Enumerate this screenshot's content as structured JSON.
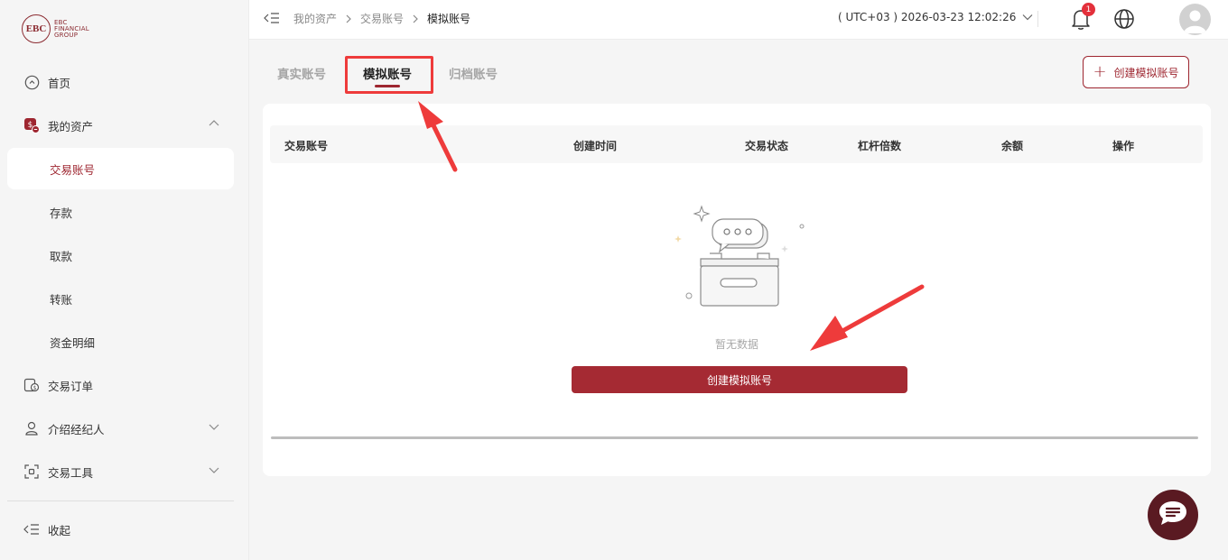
{
  "brand": {
    "logo_mark": "EBC",
    "logo_text_lines": [
      "EBC",
      "FINANCIAL",
      "GROUP"
    ]
  },
  "sidebar": {
    "items": [
      {
        "label": "首页",
        "icon": "home-icon"
      },
      {
        "label": "我的资产",
        "icon": "wallet-icon",
        "expanded": true
      },
      {
        "label": "交易账号",
        "active": true
      },
      {
        "label": "存款"
      },
      {
        "label": "取款"
      },
      {
        "label": "转账"
      },
      {
        "label": "资金明细"
      },
      {
        "label": "交易订单",
        "icon": "orders-icon"
      },
      {
        "label": "介绍经纪人",
        "icon": "person-icon"
      },
      {
        "label": "交易工具",
        "icon": "tools-icon"
      }
    ],
    "collapse_label": "收起"
  },
  "header": {
    "breadcrumb": [
      "我的资产",
      "交易账号",
      "模拟账号"
    ],
    "timezone": "( UTC+03 ) 2026-03-23 12:02:26",
    "notifications_count": "1"
  },
  "tabs": [
    {
      "label": "真实账号"
    },
    {
      "label": "模拟账号",
      "active": true
    },
    {
      "label": "归档账号"
    }
  ],
  "create_demo_top_label": "创建模拟账号",
  "table": {
    "columns": [
      "交易账号",
      "创建时间",
      "交易状态",
      "杠杆倍数",
      "余额",
      "操作"
    ]
  },
  "empty_text": "暂无数据",
  "create_demo_main_label": "创建模拟账号",
  "colors": {
    "brand": "#a52a33",
    "annotation_red": "#ee3b3b",
    "chat": "#5a1a22"
  }
}
